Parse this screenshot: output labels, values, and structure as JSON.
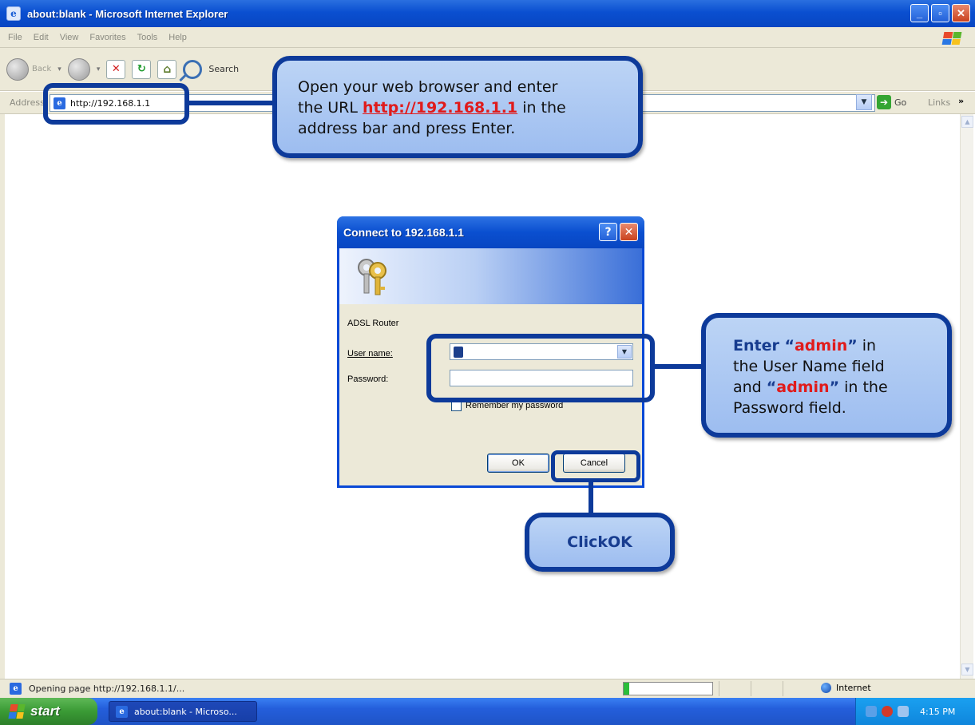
{
  "window": {
    "title": "about:blank - Microsoft Internet Explorer",
    "minimize": "_",
    "maximize": "▫",
    "close": "✕"
  },
  "menu": [
    "File",
    "Edit",
    "View",
    "Favorites",
    "Tools",
    "Help"
  ],
  "toolbar": {
    "back_label": "Back",
    "search_label": "Search"
  },
  "address": {
    "label": "Address",
    "url": "http://192.168.1.1",
    "go_label": "Go",
    "links_label": "Links",
    "links_chevron": "»"
  },
  "status": {
    "text": "Opening page http://192.168.1.1/...",
    "progress_fraction": 0.06,
    "zone": "Internet"
  },
  "taskbar": {
    "start_label": "start",
    "task_label": "about:blank - Microso...",
    "clock": "4:15 PM"
  },
  "dialog": {
    "title": "Connect to 192.168.1.1",
    "help": "?",
    "close": "✕",
    "realm": "ADSL Router",
    "username_label": "User name:",
    "password_label": "Password:",
    "username_value": "",
    "password_value": "",
    "remember_label": "Remember my password",
    "ok_label": "OK",
    "cancel_label": "Cancel"
  },
  "callouts": {
    "url": {
      "line1": "Open your web browser and enter",
      "line2_pre": "the URL ",
      "line2_link": "http://192.168.1.1",
      "line2_post": " in the",
      "line3": "address bar and press Enter."
    },
    "credentials": {
      "w_enter": "Enter ",
      "q_open": "“",
      "admin1": "admin",
      "q_close": "”",
      "in": " in",
      "line2": "the User Name field",
      "and": "and ",
      "admin2": "admin",
      "in_the": " in the",
      "line4": "Password field."
    },
    "ok": {
      "click": "Click ",
      "ok": "OK"
    }
  },
  "colors": {
    "callout_border": "#0d3a9a",
    "callout_fill": "#bcd4f5",
    "highlight_red": "#e01b1b",
    "xp_blue": "#0a4fd0"
  },
  "icons": [
    "ie-icon",
    "windows-flag-icon",
    "back-icon",
    "forward-icon",
    "stop-icon",
    "refresh-icon",
    "home-icon",
    "search-icon",
    "go-arrow-icon",
    "keys-icon",
    "user-icon",
    "globe-icon"
  ]
}
